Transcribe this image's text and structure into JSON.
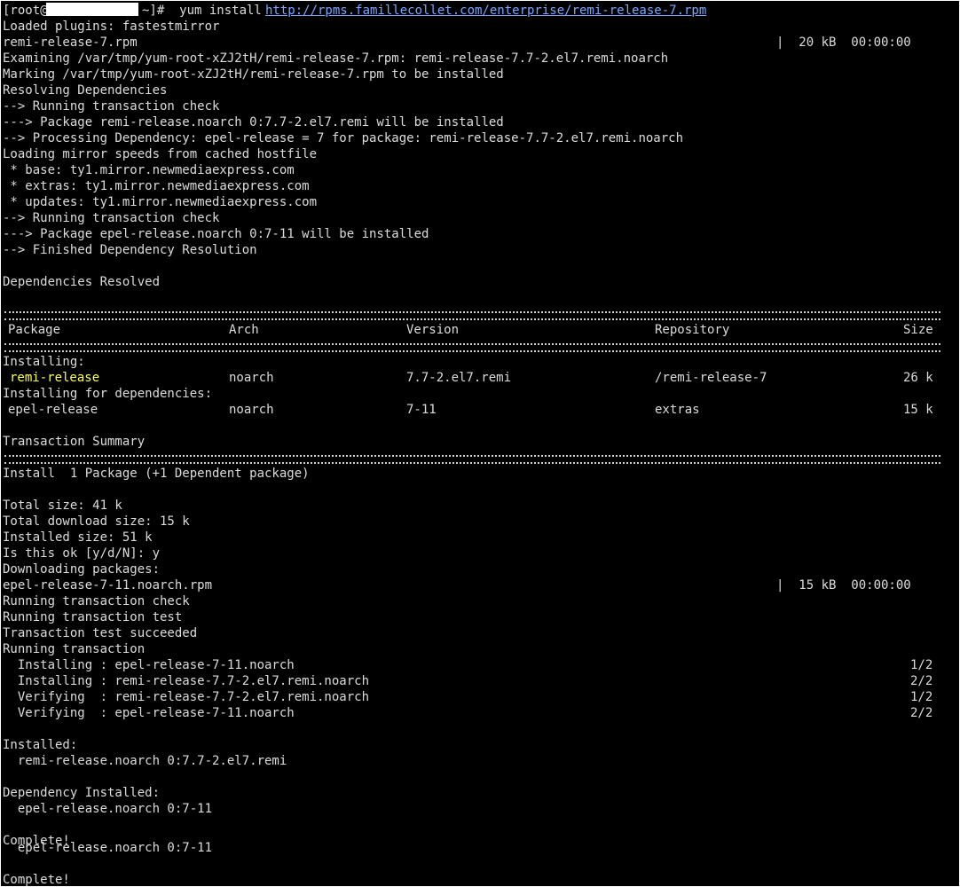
{
  "terminal": {
    "prompt_prefix": "[root@",
    "prompt_suffix": "~]#  yum install ",
    "url": "http://rpms.famillecollet.com/enterprise/remi-release-7.rpm",
    "loaded_plugins": "Loaded plugins: fastestmirror",
    "rpm_file": "remi-release-7.rpm",
    "rpm_progress": "|  20 kB  00:00:00",
    "examining": "Examining /var/tmp/yum-root-xZJ2tH/remi-release-7.rpm: remi-release-7.7-2.el7.remi.noarch",
    "marking": "Marking /var/tmp/yum-root-xZJ2tH/remi-release-7.rpm to be installed",
    "resolving": "Resolving Dependencies",
    "running_check_1": "--> Running transaction check",
    "pkg_remi": "---> Package remi-release.noarch 0:7.7-2.el7.remi will be installed",
    "processing_dep": "--> Processing Dependency: epel-release = 7 for package: remi-release-7.7-2.el7.remi.noarch",
    "loading_mirror": "Loading mirror speeds from cached hostfile",
    "mirror_base": " * base: ty1.mirror.newmediaexpress.com",
    "mirror_extras": " * extras: ty1.mirror.newmediaexpress.com",
    "mirror_updates": " * updates: ty1.mirror.newmediaexpress.com",
    "running_check_2": "--> Running transaction check",
    "pkg_epel": "---> Package epel-release.noarch 0:7-11 will be installed",
    "finished_dep": "--> Finished Dependency Resolution",
    "deps_resolved": "Dependencies Resolved",
    "table_header": {
      "package": "Package",
      "arch": "Arch",
      "version": "Version",
      "repository": "Repository",
      "size": "Size"
    },
    "installing_label": "Installing:",
    "row_remi": {
      "package": "remi-release",
      "arch": "noarch",
      "version": "7.7-2.el7.remi",
      "repository": "/remi-release-7",
      "size": "26 k"
    },
    "installing_deps_label": "Installing for dependencies:",
    "row_epel": {
      "package": "epel-release",
      "arch": "noarch",
      "version": "7-11",
      "repository": "extras",
      "size": "15 k"
    },
    "transaction_summary": "Transaction Summary",
    "install_summary": "Install  1 Package (+1 Dependent package)",
    "total_size": "Total size: 41 k",
    "total_download": "Total download size: 15 k",
    "installed_size": "Installed size: 51 k",
    "is_ok": "Is this ok [y/d/N]: y",
    "downloading": "Downloading packages:",
    "epel_rpm": "epel-release-7-11.noarch.rpm",
    "epel_progress": "|  15 kB  00:00:00",
    "running_tx_check": "Running transaction check",
    "running_tx_test": "Running transaction test",
    "tx_test_ok": "Transaction test succeeded",
    "running_tx": "Running transaction",
    "steps": [
      {
        "text": "  Installing : epel-release-7-11.noarch",
        "count": "1/2"
      },
      {
        "text": "  Installing : remi-release-7.7-2.el7.remi.noarch",
        "count": "2/2"
      },
      {
        "text": "  Verifying  : remi-release-7.7-2.el7.remi.noarch",
        "count": "1/2"
      },
      {
        "text": "  Verifying  : epel-release-7-11.noarch",
        "count": "2/2"
      }
    ],
    "installed_label": "Installed:",
    "installed_pkg": "  remi-release.noarch 0:7.7-2.el7.remi",
    "dep_installed_label": "Dependency Installed:",
    "dep_installed_pkg": "  epel-release.noarch 0:7-11",
    "complete_1": "Complete!",
    "ghost_line": "  epel-release.noarch 0:7-11",
    "complete_2": "Complete!"
  }
}
